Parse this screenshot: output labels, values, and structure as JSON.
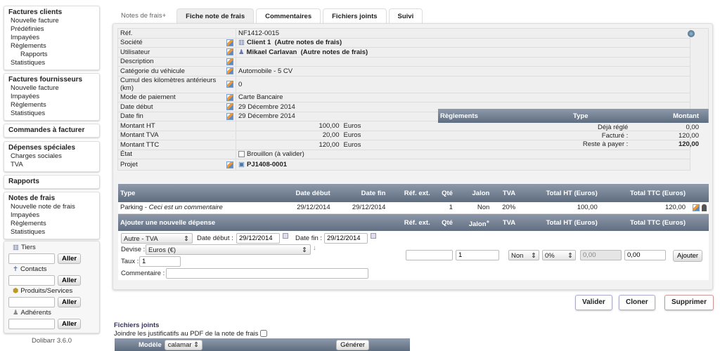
{
  "sidebar": {
    "menus": [
      {
        "title": "Factures clients",
        "items": [
          {
            "label": "Nouvelle facture"
          },
          {
            "label": "Prédéfinies"
          },
          {
            "label": "Impayées"
          },
          {
            "label": "Règlements"
          },
          {
            "label": "Rapports",
            "sub": true
          },
          {
            "label": "Statistiques"
          }
        ]
      },
      {
        "title": "Factures fournisseurs",
        "items": [
          {
            "label": "Nouvelle facture"
          },
          {
            "label": "Impayées"
          },
          {
            "label": "Règlements"
          },
          {
            "label": "Statistiques"
          }
        ]
      },
      {
        "title": "Commandes à facturer",
        "items": []
      },
      {
        "title": "Dépenses spéciales",
        "items": [
          {
            "label": "Charges sociales"
          },
          {
            "label": "TVA"
          }
        ]
      },
      {
        "title": "Rapports",
        "items": []
      },
      {
        "title": "Notes de frais",
        "items": [
          {
            "label": "Nouvelle note de frais"
          },
          {
            "label": "Impayées"
          },
          {
            "label": "Règlements"
          },
          {
            "label": "Statistiques"
          }
        ]
      }
    ],
    "search": [
      {
        "label": "Tiers",
        "icon": "company-icon"
      },
      {
        "label": "Contacts",
        "icon": "contact-icon"
      },
      {
        "label": "Produits/Services",
        "icon": "product-icon"
      },
      {
        "label": "Adhérents",
        "icon": "member-icon"
      }
    ],
    "search_button": "Aller",
    "version": "Dolibarr 3.6.0"
  },
  "tabs": [
    {
      "label": "Notes de frais+"
    },
    {
      "label": "Fiche note de frais",
      "active": true
    },
    {
      "label": "Commentaires"
    },
    {
      "label": "Fichiers joints"
    },
    {
      "label": "Suivi"
    }
  ],
  "card": {
    "rows": [
      {
        "label": "Réf.",
        "value": "NF1412-0015",
        "edit": false
      },
      {
        "label": "Société",
        "value": "Client 1",
        "extra": "(Autre notes de frais)",
        "edit": true,
        "bold": true,
        "icon": "company-icon"
      },
      {
        "label": "Utilisateur",
        "value": "Mikael Carlavan",
        "extra": "(Autre notes de frais)",
        "edit": true,
        "bold": true,
        "icon": "user-icon"
      },
      {
        "label": "Description",
        "value": "",
        "edit": true
      },
      {
        "label": "Catégorie du véhicule",
        "value": "Automobile - 5 CV",
        "edit": true
      },
      {
        "label": "Cumul des kilomètres antérieurs (km)",
        "value": "0",
        "edit": true
      },
      {
        "label": "Mode de paiement",
        "value": "Carte Bancaire",
        "edit": true
      },
      {
        "label": "Date début",
        "value": "29 Décembre 2014",
        "edit": true
      },
      {
        "label": "Date fin",
        "value": "29 Décembre 2014",
        "edit": true
      }
    ],
    "amounts": [
      {
        "label": "Montant HT",
        "value": "100,00",
        "currency": "Euros"
      },
      {
        "label": "Montant TVA",
        "value": "20,00",
        "currency": "Euros"
      },
      {
        "label": "Montant TTC",
        "value": "120,00",
        "currency": "Euros"
      }
    ],
    "status_label": "État",
    "status_value": "Brouillon (à valider)",
    "project_label": "Projet",
    "project_value": "PJ1408-0001"
  },
  "payments": {
    "headers": [
      "Règlements",
      "Type",
      "Montant"
    ],
    "rows": [
      {
        "label": "Déjà réglé",
        "value": "0,00"
      },
      {
        "label": "Facturé :",
        "value": "120,00"
      },
      {
        "label": "Reste à payer :",
        "value": "120,00",
        "bold": true
      }
    ]
  },
  "lines": {
    "headers": [
      "Type",
      "Date début",
      "Date fin",
      "Réf. ext.",
      "Qté",
      "Jalon",
      "TVA",
      "Total HT (Euros)",
      "Total TTC (Euros)"
    ],
    "rows": [
      {
        "type": "Parking",
        "comment": "Ceci est un commentaire",
        "start": "29/12/2014",
        "end": "29/12/2014",
        "ref": "",
        "qty": "1",
        "jalon": "Non",
        "tva": "20%",
        "ht": "100,00",
        "ttc": "120,00"
      }
    ],
    "add_header": {
      "title": "Ajouter une nouvelle dépense",
      "ref": "Réf. ext.",
      "qty": "Qté",
      "jalon": "Jalon",
      "tva": "TVA",
      "ht": "Total HT (Euros)",
      "ttc": "Total TTC (Euros)"
    }
  },
  "form": {
    "type": "Autre - TVA",
    "start_label": "Date début :",
    "start": "29/12/2014",
    "end_label": "Date fin :",
    "end": "29/12/2014",
    "currency_label": "Devise :",
    "currency": "Euros (€)",
    "rate_label": "Taux :",
    "rate": "1",
    "comment_label": "Commentaire :",
    "comment": "",
    "ref": "",
    "qty": "1",
    "jalon": "Non",
    "tva": "0%",
    "ht": "0,00",
    "ttc": "0,00",
    "add_button": "Ajouter"
  },
  "actions": {
    "validate": "Valider",
    "clone": "Cloner",
    "delete": "Supprimer"
  },
  "files": {
    "title": "Fichiers joints",
    "attach_label": "Joindre les justificatifs au PDF de la note de frais",
    "model_label": "Modèle",
    "model": "calamar",
    "generate": "Générer"
  }
}
